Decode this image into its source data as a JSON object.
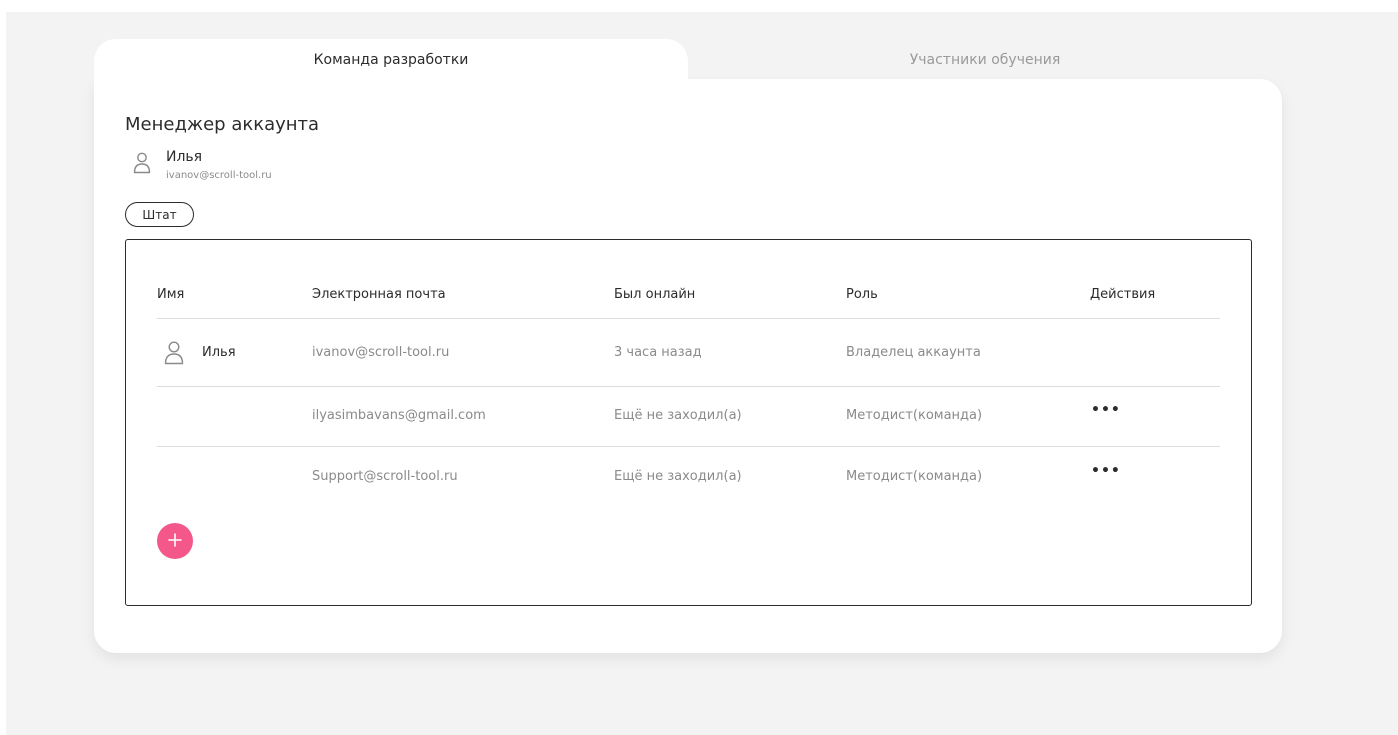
{
  "tabs": [
    {
      "label": "Команда разработки",
      "active": true
    },
    {
      "label": "Участники обучения",
      "active": false
    }
  ],
  "manager": {
    "section_title": "Менеджер аккаунта",
    "name": "Илья",
    "email": "ivanov@scroll-tool.ru",
    "icon": "user-icon"
  },
  "staff_button_label": "Штат",
  "table": {
    "headers": [
      "Имя",
      "Электронная почта",
      "Был онлайн",
      "Роль",
      "Действия"
    ],
    "rows": [
      {
        "name": "Илья",
        "email": "ivanov@scroll-tool.ru",
        "last_online": "3 часа назад",
        "role": "Владелец аккаунта",
        "actions": ""
      },
      {
        "name": "",
        "email": "ilyasimbavans@gmail.com",
        "last_online": "Ещё не заходил(а)",
        "role": "Методист(команда)",
        "actions": "•••"
      },
      {
        "name": "",
        "email": "Support@scroll-tool.ru",
        "last_online": "Ещё не заходил(а)",
        "role": "Методист(команда)",
        "actions": "•••"
      }
    ]
  },
  "add_button": {
    "icon": "plus-icon",
    "label": "+"
  },
  "colors": {
    "accent": "#f4588a",
    "background": "#f3f3f3",
    "text": "#2c2c2c",
    "muted": "#8a8a8a"
  }
}
